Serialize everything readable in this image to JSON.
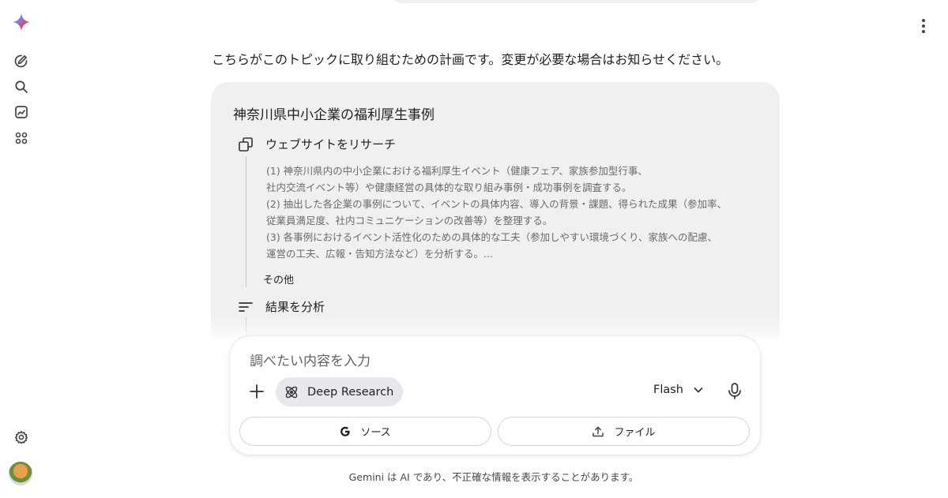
{
  "conversation": {
    "intro": "こちらがこのトピックに取り組むための計画です。変更が必要な場合はお知らせください。"
  },
  "plan": {
    "title": "神奈川県中小企業の福利厚生事例",
    "step1_label": "ウェブサイトをリサーチ",
    "lines": [
      "(1) 神奈川県内の中小企業における福利厚生イベント（健康フェア、家族参加型行事、",
      "社内交流イベント等）や健康経営の具体的な取り組み事例・成功事例を調査する。",
      "(2) 抽出した各企業の事例について、イベントの具体内容、導入の背景・課題、得られた成果（参加率、",
      "従業員満足度、社内コミュニケーションの改善等）を整理する。",
      "(3) 各事例におけるイベント活性化のための具体的な工夫（参加しやすい環境づくり、家族への配慮、",
      "運営の工夫、広報・告知方法など）を分析する。..."
    ],
    "more_label": "その他",
    "step2_label": "結果を分析"
  },
  "composer": {
    "placeholder": "調べたい内容を入力",
    "tool_chip": "Deep Research",
    "model": "Flash",
    "source_button": "ソース",
    "file_button": "ファイル"
  },
  "footer": {
    "disclaimer": "Gemini は AI であり、不正確な情報を表示することがあります。"
  },
  "icons": {
    "logo": "gemini-spark-icon",
    "new_chat": "edit-icon",
    "search": "search-icon",
    "gallery": "image-icon",
    "apps": "apps-grid-icon",
    "settings": "gear-icon",
    "menu": "more-vert-icon"
  }
}
